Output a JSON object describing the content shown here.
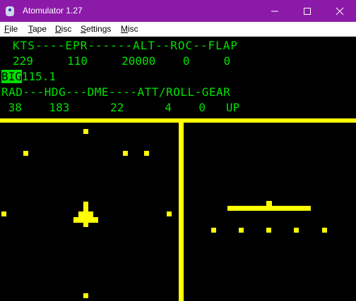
{
  "window": {
    "title": "Atomulator 1.27"
  },
  "menu": [
    {
      "mnemonic": "F",
      "rest": "ile"
    },
    {
      "mnemonic": "T",
      "rest": "ape"
    },
    {
      "mnemonic": "D",
      "rest": "isc"
    },
    {
      "mnemonic": "S",
      "rest": "ettings"
    },
    {
      "mnemonic": "M",
      "rest": "isc"
    }
  ],
  "screen": {
    "row1": "KTS----EPR------ALT--ROC--FLAP",
    "row2": "229     110     20000    0     0",
    "row3_box": "BIG",
    "row3_rest": "115.1",
    "row4": "RAD---HDG---DME----ATT/ROLL-GEAR",
    "row5": " 38    183      22      4    0   UP"
  },
  "colors": {
    "text": "#00e000",
    "graphics": "#ffff00",
    "titlebar": "#8c1aa8"
  }
}
